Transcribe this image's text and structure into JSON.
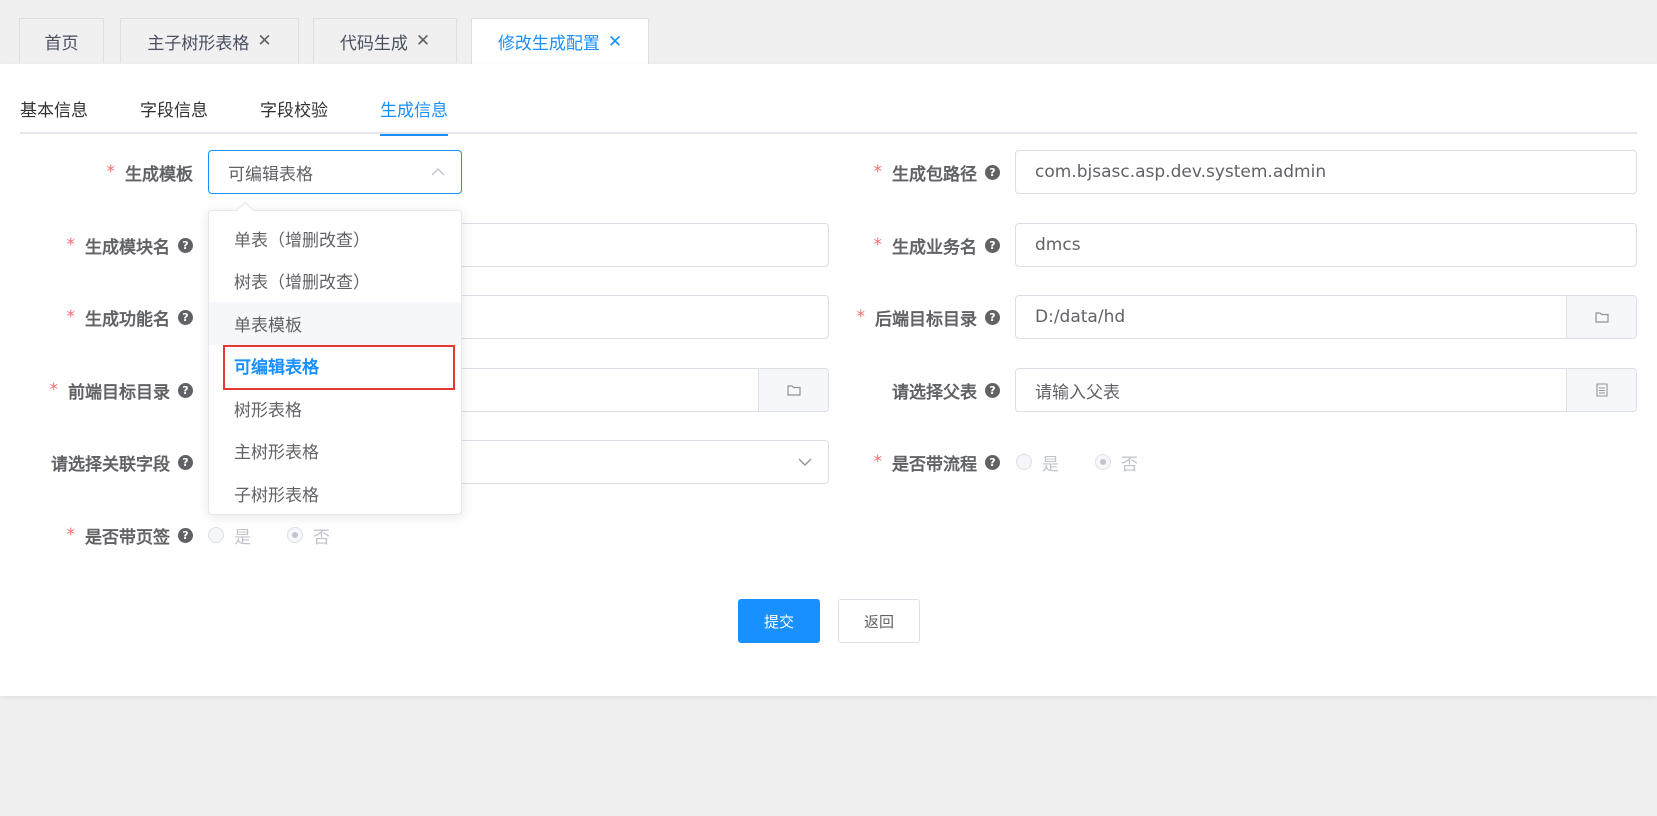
{
  "top_tabs": [
    {
      "label": "首页"
    },
    {
      "label": "主子树形表格",
      "close": "✕"
    },
    {
      "label": "代码生成",
      "close": "✕"
    },
    {
      "label": "修改生成配置",
      "close": "✕"
    }
  ],
  "inner_tabs": [
    "基本信息",
    "字段信息",
    "字段校验",
    "生成信息"
  ],
  "form": {
    "template": {
      "label": "生成模板",
      "value": "可编辑表格"
    },
    "package_path": {
      "label": "生成包路径",
      "value": "com.bjsasc.asp.dev.system.admin"
    },
    "module_name": {
      "label": "生成模块名"
    },
    "business_name": {
      "label": "生成业务名",
      "value": "dmcs"
    },
    "function_name": {
      "label": "生成功能名"
    },
    "backend_dir": {
      "label": "后端目标目录",
      "value": "D:/data/hd"
    },
    "frontend_dir": {
      "label": "前端目标目录"
    },
    "parent_table": {
      "label": "请选择父表",
      "value": "请输入父表"
    },
    "relation_field": {
      "label": "请选择关联字段"
    },
    "with_flow": {
      "label": "是否带流程",
      "options": [
        "是",
        "否"
      ],
      "selected": "否"
    },
    "with_tabs": {
      "label": "是否带页签",
      "options": [
        "是",
        "否"
      ],
      "selected": "否"
    }
  },
  "dropdown": {
    "options": [
      "单表（增删改查）",
      "树表（增删改查）",
      "单表模板",
      "可编辑表格",
      "树形表格",
      "主树形表格",
      "子树形表格"
    ],
    "hovered": "单表模板",
    "selected": "可编辑表格"
  },
  "buttons": {
    "submit": "提交",
    "back": "返回"
  },
  "colors": {
    "accent": "#1890ff",
    "required": "#f56c6c",
    "highlight_box": "#e53935"
  }
}
